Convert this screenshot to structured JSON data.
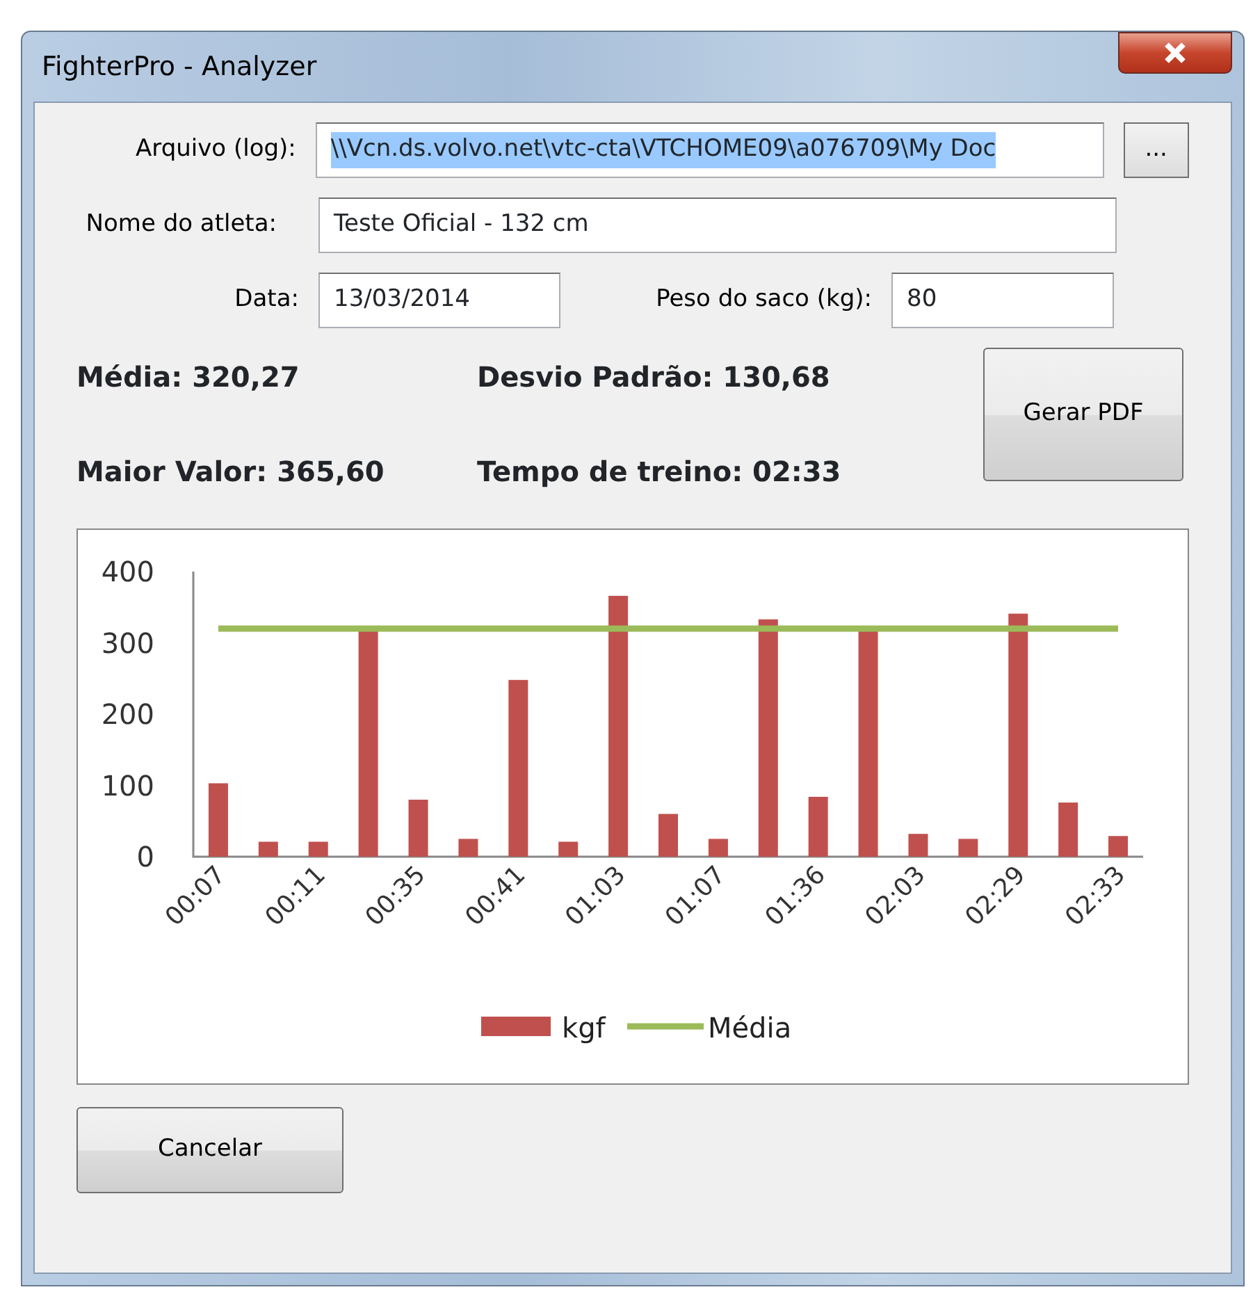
{
  "window": {
    "title": "FighterPro - Analyzer"
  },
  "fields": [
    {
      "label": "Arquivo (log):",
      "value": "\\\\Vcn.ds.volvo.net\\vtc-cta\\VTCHOME09\\a076709\\My Doc",
      "selected": true,
      "browse": "..."
    },
    {
      "label": "Nome do atleta:",
      "value": "Teste Oficial - 132 cm",
      "selected": false
    },
    {
      "label": "Data:",
      "value": "13/03/2014",
      "selected": false
    },
    {
      "label": "Peso do saco (kg):",
      "value": "80",
      "selected": false
    }
  ],
  "stats": [
    "Média: 320,27",
    "Desvio Padrão: 130,68",
    "Maior Valor: 365,60",
    "Tempo de treino: 02:33"
  ],
  "pdf_button": "Gerar PDF",
  "chart_data": {
    "type": "bar",
    "categories": [
      "00:07",
      null,
      "00:11",
      null,
      "00:35",
      null,
      "00:41",
      null,
      "01:03",
      null,
      "01:07",
      null,
      "01:36",
      null,
      "02:03",
      null,
      "02:29",
      null,
      "02:33"
    ],
    "legend": "bottom",
    "ylim": [
      0,
      400
    ],
    "yticks": [
      0,
      100,
      200,
      300,
      400
    ],
    "series": [
      {
        "name": "kgf",
        "color": "#c0504d",
        "type": "bar",
        "values": [
          103,
          21,
          21,
          318,
          80,
          25,
          248,
          21,
          366,
          60,
          25,
          333,
          84,
          320,
          32,
          25,
          341,
          76,
          29
        ]
      },
      {
        "name": "Média",
        "color": "#9bbb59",
        "type": "line",
        "values": [
          320,
          320,
          320,
          320,
          320,
          320,
          320,
          320,
          320,
          320,
          320,
          320,
          320,
          320,
          320,
          320,
          320,
          320,
          320
        ]
      }
    ]
  },
  "cancel_button": "Cancelar"
}
